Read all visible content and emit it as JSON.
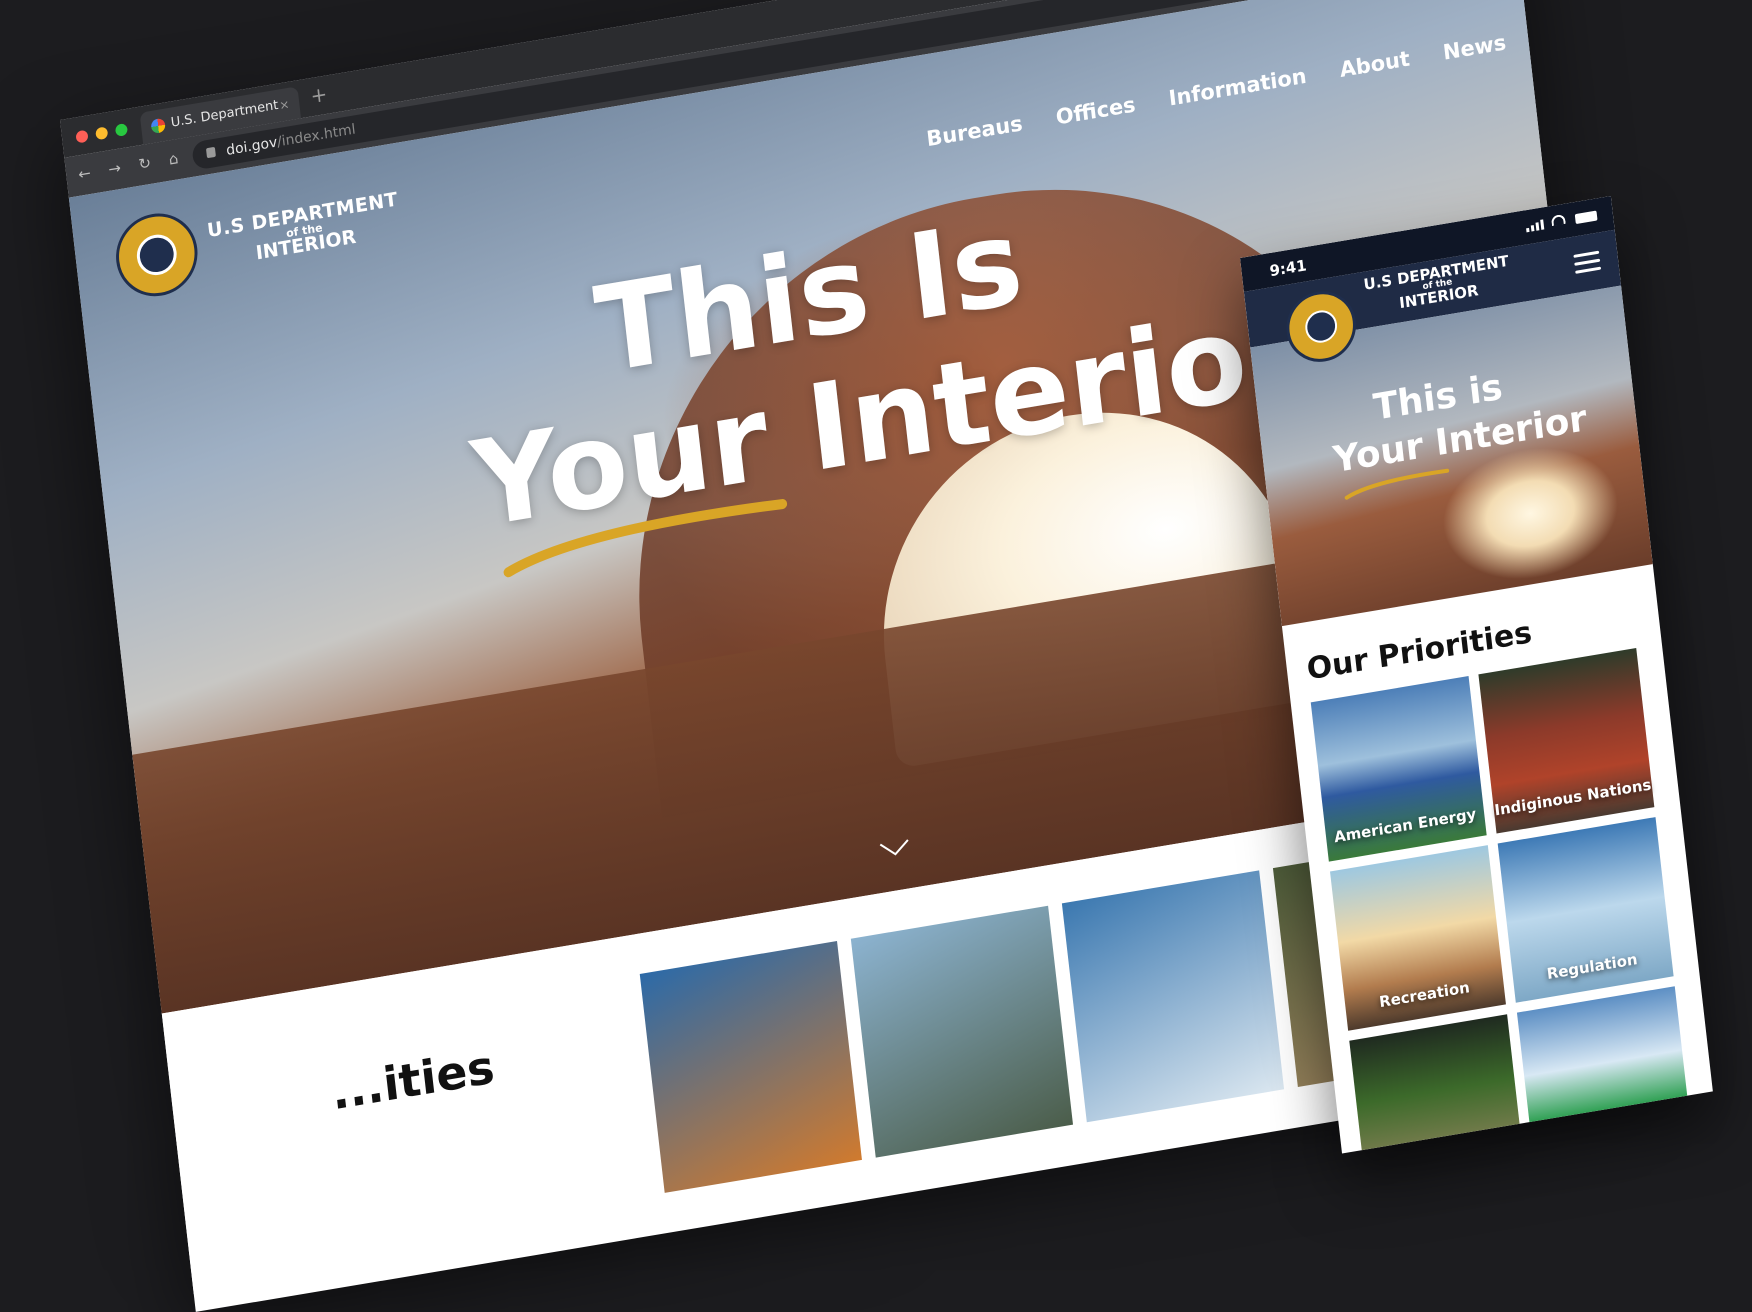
{
  "browser": {
    "tab_title": "U.S. Department",
    "url_host": "doi.gov",
    "url_path": "/index.html",
    "new_tab_symbol": "+",
    "tab_close_symbol": "×"
  },
  "desktop": {
    "nav": [
      "Bureaus",
      "Offices",
      "Information",
      "About",
      "News"
    ],
    "logo": {
      "line1": "U.S DEPARTMENT",
      "line2": "of the",
      "line3": "INTERIOR"
    },
    "headline": {
      "line1": "This Is",
      "line2": "Your Interior"
    },
    "section_partial": "...ities"
  },
  "phone": {
    "status_time": "9:41",
    "logo": {
      "line1": "U.S DEPARTMENT",
      "line2": "of the",
      "line3": "INTERIOR"
    },
    "headline": {
      "line1": "This is",
      "line2": "Your Interior"
    },
    "priorities_title": "Our Priorities",
    "cards": [
      "American Energy",
      "Indiginous Nations",
      "Recreation",
      "Regulation",
      "",
      ""
    ]
  },
  "colors": {
    "page_bg": "#1c1c1f",
    "accent_gold": "#d9a526",
    "navy": "#1f2b45"
  }
}
